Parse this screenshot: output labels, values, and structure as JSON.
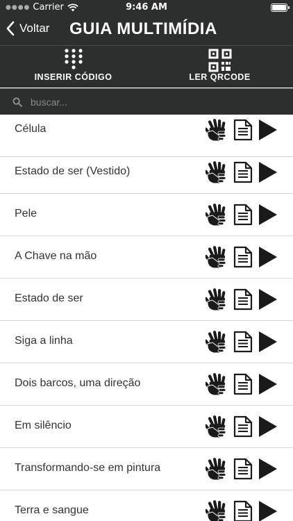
{
  "status_bar": {
    "carrier": "Carrier",
    "time": "9:46 AM"
  },
  "nav": {
    "back_label": "Voltar",
    "title": "GUIA MULTIMÍDIA"
  },
  "actions": {
    "insert_code": "INSERIR CÓDIGO",
    "read_qrcode": "LER QRCODE"
  },
  "search": {
    "placeholder": "buscar..."
  },
  "items": [
    {
      "title": "Célula"
    },
    {
      "title": "Estado de ser (Vestido)"
    },
    {
      "title": "Pele"
    },
    {
      "title": "A Chave na mão"
    },
    {
      "title": "Estado de ser"
    },
    {
      "title": "Siga a linha"
    },
    {
      "title": "Dois barcos, uma direção"
    },
    {
      "title": "Em silêncio"
    },
    {
      "title": "Transformando-se em pintura"
    },
    {
      "title": "Terra e sangue"
    }
  ],
  "icons": {
    "row": [
      "sign-language-icon",
      "document-icon",
      "play-icon"
    ]
  },
  "colors": {
    "header_bg": "#2d2f2e",
    "text": "#333333",
    "divider": "#d8d8d8"
  }
}
